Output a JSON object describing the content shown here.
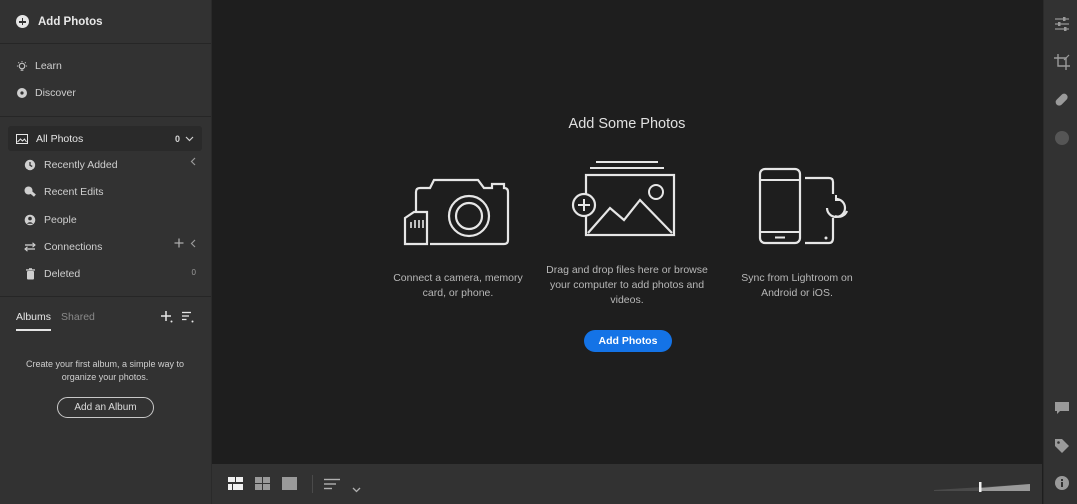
{
  "sidebar": {
    "add_photos_label": "Add Photos",
    "learn_label": "Learn",
    "discover_label": "Discover",
    "all_photos": {
      "label": "All Photos",
      "count": "0"
    },
    "items": [
      {
        "label": "Recently Added",
        "icon": "clock-icon",
        "right": "<"
      },
      {
        "label": "Recent Edits",
        "icon": "edit-icon",
        "right": ""
      },
      {
        "label": "People",
        "icon": "person-icon",
        "right": ""
      },
      {
        "label": "Connections",
        "icon": "connections-icon",
        "right": "+ <"
      },
      {
        "label": "Deleted",
        "icon": "trash-icon",
        "right": "0"
      }
    ],
    "albums": {
      "tab_albums": "Albums",
      "tab_shared": "Shared",
      "hint": "Create your first album, a simple way to organize your photos.",
      "add_album_label": "Add an Album"
    }
  },
  "main": {
    "title": "Add Some Photos",
    "options": [
      {
        "caption": "Connect a camera, memory card, or phone.",
        "icon": "camera-icon"
      },
      {
        "caption": "Drag and drop files here or browse your computer to add photos and videos.",
        "icon": "photos-import-icon"
      },
      {
        "caption": "Sync from Lightroom on Android or iOS.",
        "icon": "phone-sync-icon"
      }
    ],
    "add_button_label": "Add Photos"
  },
  "colors": {
    "accent": "#1473e6",
    "panel": "#323232",
    "background": "#1e1e1e",
    "text": "#cfcfcf"
  }
}
